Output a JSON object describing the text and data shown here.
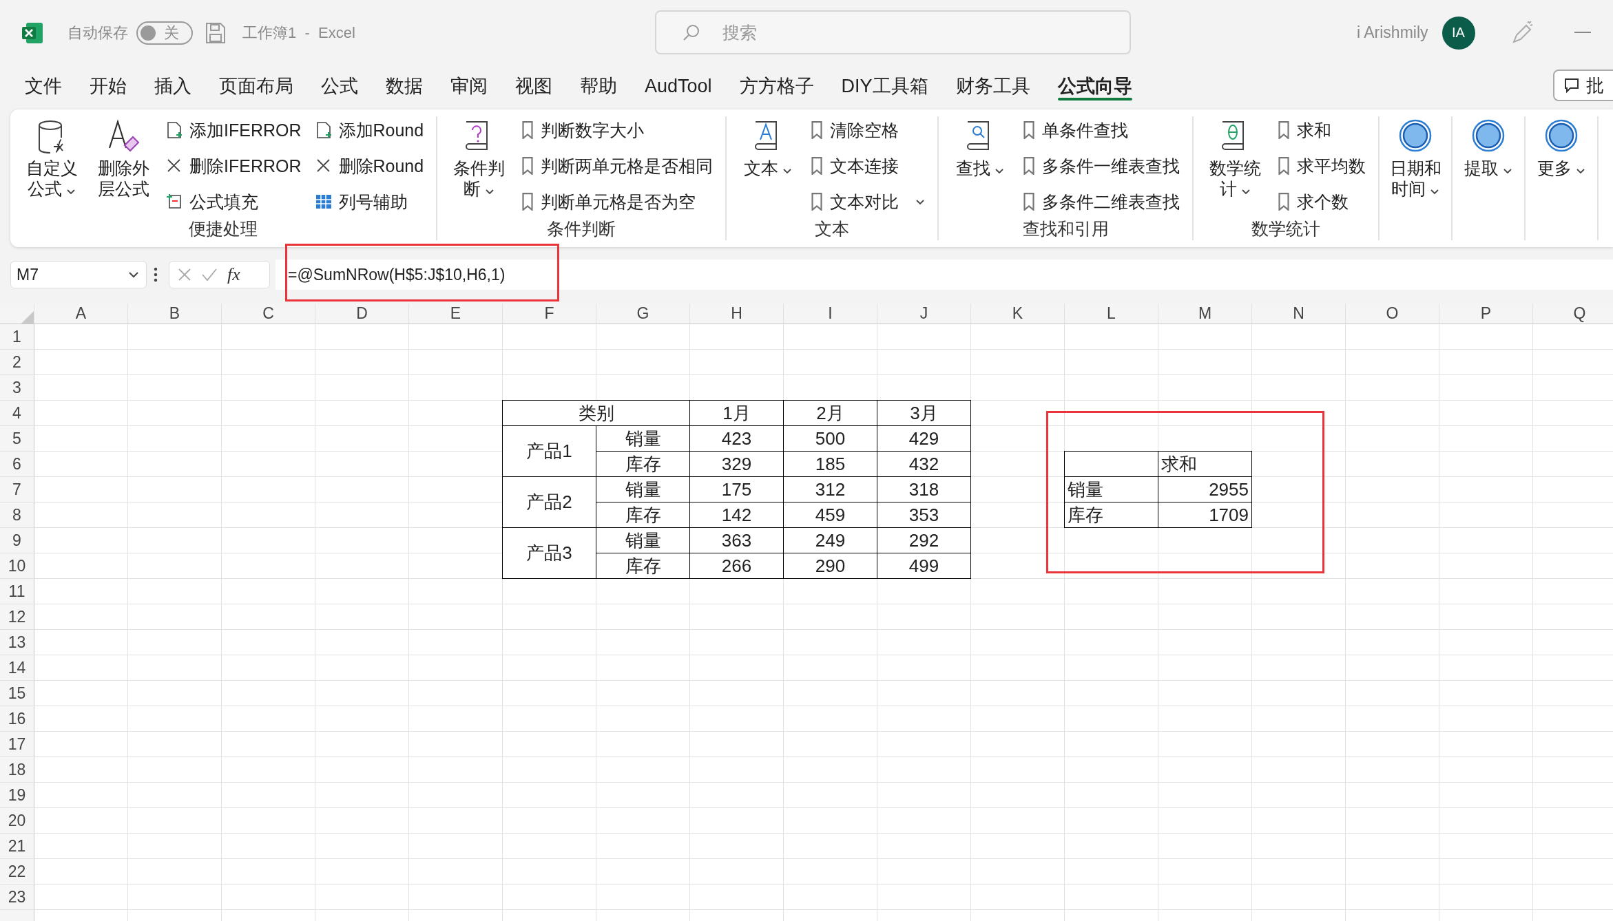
{
  "title_bar": {
    "autosave_label": "自动保存",
    "autosave": {
      "on": false,
      "label": "关"
    },
    "document_title": "工作簿1  -  Excel",
    "search": {
      "placeholder": "搜索"
    },
    "user_name": "i Arishmily",
    "avatar_initials": "IA"
  },
  "ribbon_tabs": [
    {
      "label": "文件",
      "selected": false
    },
    {
      "label": "开始",
      "selected": false
    },
    {
      "label": "插入",
      "selected": false
    },
    {
      "label": "页面布局",
      "selected": false
    },
    {
      "label": "公式",
      "selected": false
    },
    {
      "label": "数据",
      "selected": false
    },
    {
      "label": "审阅",
      "selected": false
    },
    {
      "label": "视图",
      "selected": false
    },
    {
      "label": "帮助",
      "selected": false
    },
    {
      "label": "AudTool",
      "selected": false
    },
    {
      "label": "方方格子",
      "selected": false
    },
    {
      "label": "DIY工具箱",
      "selected": false
    },
    {
      "label": "财务工具",
      "selected": false
    },
    {
      "label": "公式向导",
      "selected": true
    }
  ],
  "comments_button": {
    "label": "批"
  },
  "ribbon_groups": [
    {
      "label": "便捷处理",
      "large": [
        {
          "label": "自定义公式",
          "dropdown": true
        },
        {
          "label": "删除外层公式",
          "dropdown": false
        }
      ],
      "small_columns": [
        [
          {
            "label": "添加IFERROR",
            "dropdown": false
          },
          {
            "label": "删除IFERROR",
            "dropdown": false
          },
          {
            "label": "公式填充",
            "dropdown": false
          }
        ],
        [
          {
            "label": "添加Round",
            "dropdown": false
          },
          {
            "label": "删除Round",
            "dropdown": false
          },
          {
            "label": "列号辅助",
            "dropdown": false
          }
        ]
      ]
    },
    {
      "label": "条件判断",
      "large": [
        {
          "label": "条件判断",
          "dropdown": true
        }
      ],
      "small_columns": [
        [
          {
            "label": "判断数字大小",
            "dropdown": false
          },
          {
            "label": "判断两单元格是否相同",
            "dropdown": false
          },
          {
            "label": "判断单元格是否为空",
            "dropdown": false
          }
        ]
      ]
    },
    {
      "label": "文本",
      "large": [
        {
          "label": "文本",
          "dropdown": true
        }
      ],
      "small_columns": [
        [
          {
            "label": "清除空格",
            "dropdown": false
          },
          {
            "label": "文本连接",
            "dropdown": false
          },
          {
            "label": "文本对比",
            "dropdown": true
          }
        ]
      ]
    },
    {
      "label": "查找和引用",
      "large": [
        {
          "label": "查找",
          "dropdown": true
        }
      ],
      "small_columns": [
        [
          {
            "label": "单条件查找",
            "dropdown": false
          },
          {
            "label": "多条件一维表查找",
            "dropdown": false
          },
          {
            "label": "多条件二维表查找",
            "dropdown": false
          }
        ]
      ]
    },
    {
      "label": "数学统计",
      "large": [
        {
          "label": "数学统计",
          "dropdown": true
        }
      ],
      "small_columns": [
        [
          {
            "label": "求和",
            "dropdown": false
          },
          {
            "label": "求平均数",
            "dropdown": false
          },
          {
            "label": "求个数",
            "dropdown": false
          }
        ]
      ]
    },
    {
      "large": [
        {
          "label": "日期和时间",
          "dropdown": true
        }
      ]
    },
    {
      "large": [
        {
          "label": "提取",
          "dropdown": true
        }
      ]
    },
    {
      "large": [
        {
          "label": "更多",
          "dropdown": true
        }
      ]
    }
  ],
  "formula_bar": {
    "name_box": "M7",
    "function_symbol": "fx",
    "formula": "=@SumNRow(H$5:J$10,H6,1)"
  },
  "sheet": {
    "columns": [
      "A",
      "B",
      "C",
      "D",
      "E",
      "F",
      "G",
      "H",
      "I",
      "J",
      "K",
      "L",
      "M",
      "N",
      "O",
      "P",
      "Q"
    ],
    "rows": [
      "1",
      "2",
      "3",
      "4",
      "5",
      "6",
      "7",
      "8",
      "9",
      "10",
      "11",
      "12",
      "13",
      "14",
      "15",
      "16",
      "17",
      "18",
      "19",
      "20",
      "21",
      "22",
      "23"
    ],
    "sales_table": {
      "header": [
        "类别",
        "1月",
        "2月",
        "3月"
      ],
      "groups": [
        {
          "product": "产品1",
          "rows": [
            {
              "metric": "销量",
              "values": [
                "423",
                "500",
                "429"
              ]
            },
            {
              "metric": "库存",
              "values": [
                "329",
                "185",
                "432"
              ]
            }
          ]
        },
        {
          "product": "产品2",
          "rows": [
            {
              "metric": "销量",
              "values": [
                "175",
                "312",
                "318"
              ]
            },
            {
              "metric": "库存",
              "values": [
                "142",
                "459",
                "353"
              ]
            }
          ]
        },
        {
          "product": "产品3",
          "rows": [
            {
              "metric": "销量",
              "values": [
                "363",
                "249",
                "292"
              ]
            },
            {
              "metric": "库存",
              "values": [
                "266",
                "290",
                "499"
              ]
            }
          ]
        }
      ]
    },
    "summary_table": {
      "header": "求和",
      "rows": [
        {
          "label": "销量",
          "value": "2955"
        },
        {
          "label": "库存",
          "value": "1709"
        }
      ]
    }
  }
}
